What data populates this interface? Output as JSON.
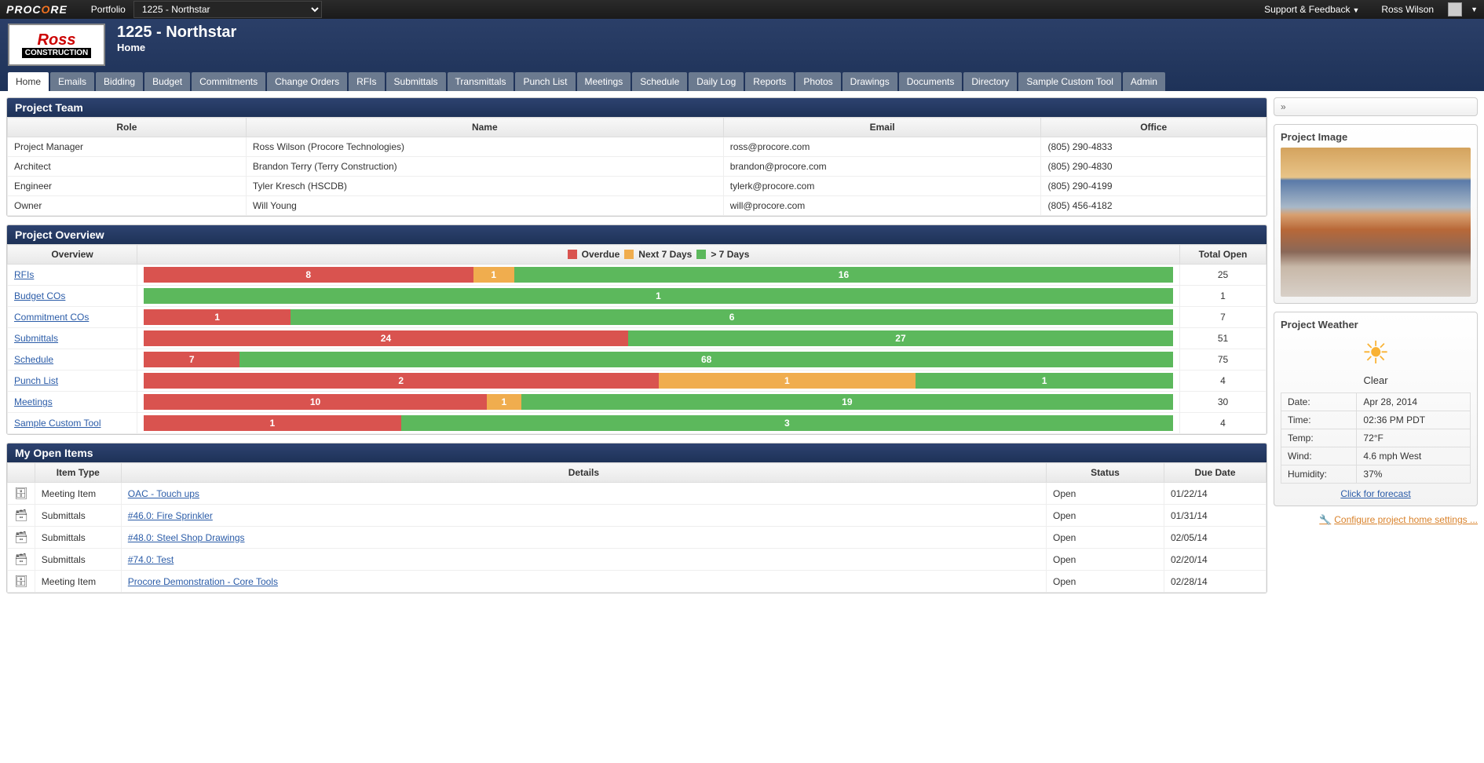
{
  "topbar": {
    "logo_pre": "PROC",
    "logo_o": "O",
    "logo_post": "RE",
    "portfolio_label": "Portfolio",
    "project_select": "1225 - Northstar",
    "support_label": "Support & Feedback",
    "user_name": "Ross Wilson"
  },
  "header": {
    "project_title": "1225 - Northstar",
    "breadcrumb": "Home",
    "company_ross": "Ross",
    "company_constr": "CONSTRUCTION"
  },
  "tabs": [
    "Home",
    "Emails",
    "Bidding",
    "Budget",
    "Commitments",
    "Change Orders",
    "RFIs",
    "Submittals",
    "Transmittals",
    "Punch List",
    "Meetings",
    "Schedule",
    "Daily Log",
    "Reports",
    "Photos",
    "Drawings",
    "Documents",
    "Directory",
    "Sample Custom Tool",
    "Admin"
  ],
  "active_tab": "Home",
  "project_team": {
    "title": "Project Team",
    "headers": [
      "Role",
      "Name",
      "Email",
      "Office"
    ],
    "rows": [
      {
        "role": "Project Manager",
        "name": "Ross Wilson (Procore Technologies)",
        "email": "ross@procore.com",
        "office": "(805) 290-4833"
      },
      {
        "role": "Architect",
        "name": "Brandon Terry (Terry Construction)",
        "email": "brandon@procore.com",
        "office": "(805) 290-4830"
      },
      {
        "role": "Engineer",
        "name": "Tyler Kresch (HSCDB)",
        "email": "tylerk@procore.com",
        "office": "(805) 290-4199"
      },
      {
        "role": "Owner",
        "name": "Will Young",
        "email": "will@procore.com",
        "office": "(805) 456-4182"
      }
    ]
  },
  "overview": {
    "title": "Project Overview",
    "col_overview": "Overview",
    "col_total": "Total Open",
    "legend": {
      "overdue": "Overdue",
      "next7": "Next 7 Days",
      "gt7": "> 7 Days"
    },
    "rows": [
      {
        "label": "RFIs",
        "overdue": 8,
        "next7": 1,
        "gt7": 16,
        "total": 25
      },
      {
        "label": "Budget COs",
        "overdue": 0,
        "next7": 0,
        "gt7": 1,
        "total": 1
      },
      {
        "label": "Commitment COs",
        "overdue": 1,
        "next7": 0,
        "gt7": 6,
        "total": 7
      },
      {
        "label": "Submittals",
        "overdue": 24,
        "next7": 0,
        "gt7": 27,
        "total": 51
      },
      {
        "label": "Schedule",
        "overdue": 7,
        "next7": 0,
        "gt7": 68,
        "total": 75
      },
      {
        "label": "Punch List",
        "overdue": 2,
        "next7": 1,
        "gt7": 1,
        "total": 4
      },
      {
        "label": "Meetings",
        "overdue": 10,
        "next7": 1,
        "gt7": 19,
        "total": 30
      },
      {
        "label": "Sample Custom Tool",
        "overdue": 1,
        "next7": 0,
        "gt7": 3,
        "total": 4
      }
    ]
  },
  "open_items": {
    "title": "My Open Items",
    "headers": [
      "",
      "Item Type",
      "Details",
      "Status",
      "Due Date"
    ],
    "rows": [
      {
        "icon": "meeting",
        "type": "Meeting Item",
        "details": "OAC - Touch ups",
        "status": "Open",
        "due": "01/22/14"
      },
      {
        "icon": "submittal",
        "type": "Submittals",
        "details": "#46.0: Fire Sprinkler",
        "status": "Open",
        "due": "01/31/14"
      },
      {
        "icon": "submittal",
        "type": "Submittals",
        "details": "#48.0: Steel Shop Drawings",
        "status": "Open",
        "due": "02/05/14"
      },
      {
        "icon": "submittal",
        "type": "Submittals",
        "details": "#74.0: Test",
        "status": "Open",
        "due": "02/20/14"
      },
      {
        "icon": "meeting",
        "type": "Meeting Item",
        "details": "Procore Demonstration - Core Tools",
        "status": "Open",
        "due": "02/28/14"
      }
    ]
  },
  "sidebar": {
    "image_title": "Project Image",
    "weather_title": "Project Weather",
    "weather_status": "Clear",
    "weather_rows": [
      {
        "k": "Date:",
        "v": "Apr 28, 2014"
      },
      {
        "k": "Time:",
        "v": "02:36 PM PDT"
      },
      {
        "k": "Temp:",
        "v": "72°F"
      },
      {
        "k": "Wind:",
        "v": "4.6 mph West"
      },
      {
        "k": "Humidity:",
        "v": "37%"
      }
    ],
    "forecast_link": "Click for forecast",
    "config_link": "Configure project home settings ..."
  }
}
